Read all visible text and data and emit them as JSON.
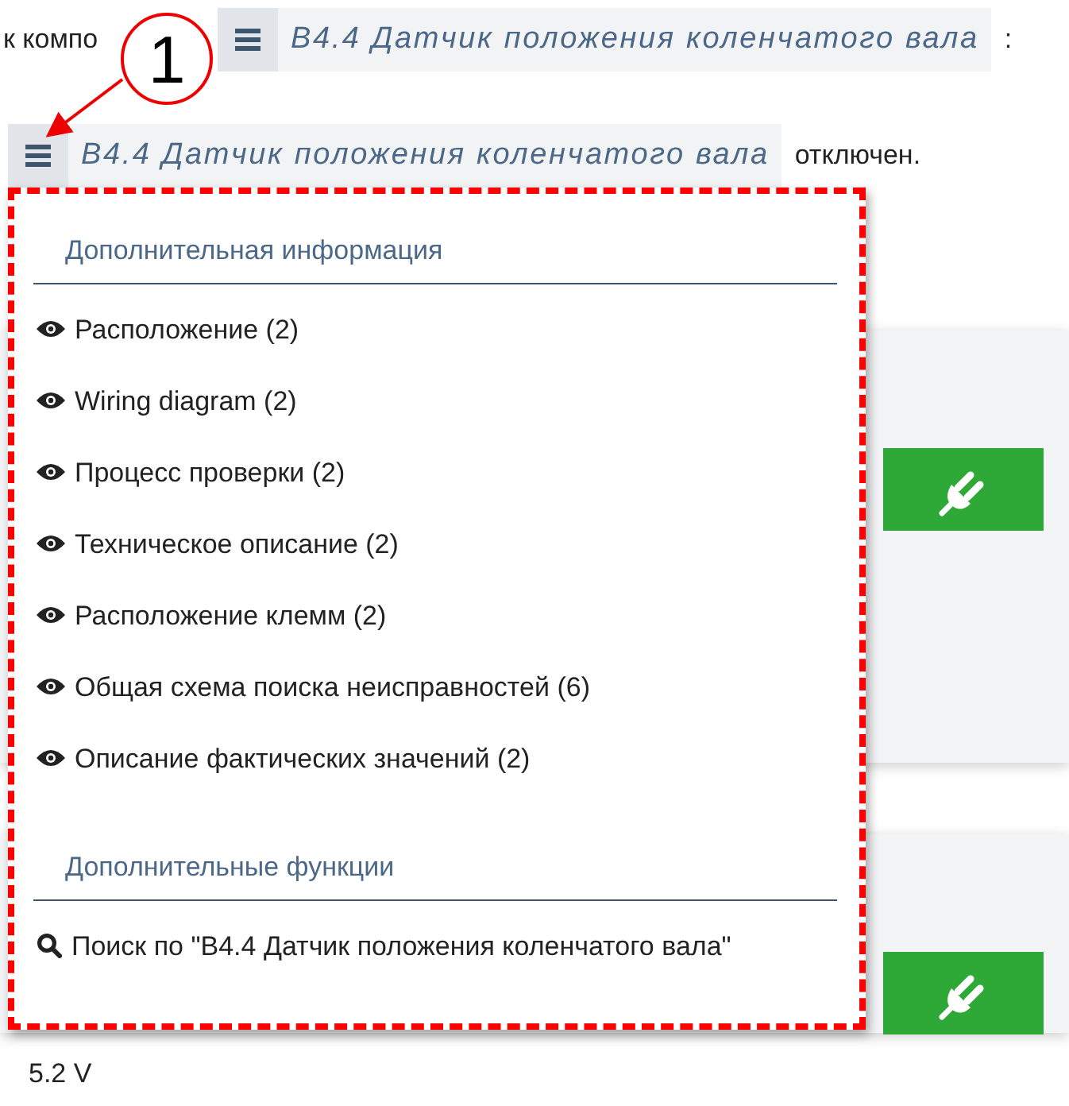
{
  "sentence1": {
    "prefix": "к компо",
    "component": "B4.4 Датчик положения коленчатого вала",
    "suffix": ":"
  },
  "sentence2": {
    "component": "B4.4 Датчик положения коленчатого вала",
    "suffix": "отключен."
  },
  "callout": {
    "number": "1"
  },
  "dropdown": {
    "sections": [
      {
        "heading": "Дополнительная информация",
        "items": [
          {
            "kind": "view",
            "label": "Расположение (2)"
          },
          {
            "kind": "view",
            "label": "Wiring diagram (2)"
          },
          {
            "kind": "view",
            "label": "Процесс проверки (2)"
          },
          {
            "kind": "view",
            "label": "Техническое описание (2)"
          },
          {
            "kind": "view",
            "label": "Расположение клемм (2)"
          },
          {
            "kind": "view",
            "label": "Общая схема поиска неисправностей (6)"
          },
          {
            "kind": "view",
            "label": "Описание фактических значений (2)"
          }
        ]
      },
      {
        "heading": "Дополнительные функции",
        "items": [
          {
            "kind": "search",
            "label": "Поиск по \"B4.4 Датчик положения коленчатого вала\""
          }
        ]
      }
    ]
  },
  "cards": [
    {
      "kind": "connect"
    },
    {
      "kind": "connect"
    }
  ],
  "reading": "5.2 V"
}
